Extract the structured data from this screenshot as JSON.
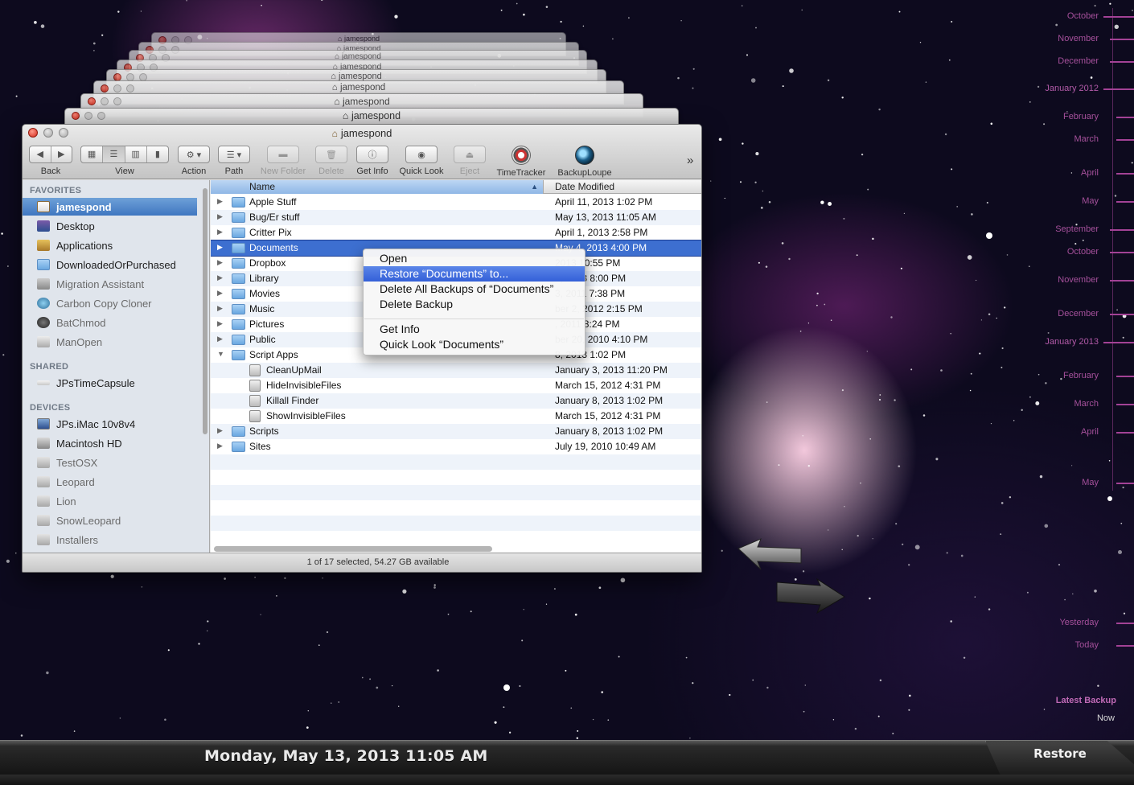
{
  "window": {
    "title": "jamespond",
    "stack_title": "jamespond"
  },
  "toolbar": {
    "back_label": "Back",
    "view_label": "View",
    "action_label": "Action",
    "path_label": "Path",
    "new_folder_label": "New Folder",
    "delete_label": "Delete",
    "get_info_label": "Get Info",
    "quick_look_label": "Quick Look",
    "eject_label": "Eject",
    "timetracker_label": "TimeTracker",
    "backuploupe_label": "BackupLoupe",
    "overflow_glyph": "»"
  },
  "sidebar": {
    "favorites_header": "FAVORITES",
    "shared_header": "SHARED",
    "devices_header": "DEVICES",
    "favorites": [
      {
        "label": "jamespond",
        "icon": "home-icon",
        "selected": true
      },
      {
        "label": "Desktop",
        "icon": "desktop-icon"
      },
      {
        "label": "Applications",
        "icon": "applications-icon"
      },
      {
        "label": "DownloadedOrPurchased",
        "icon": "folder-icon"
      },
      {
        "label": "Migration Assistant",
        "icon": "migration-assistant-icon",
        "dim": true
      },
      {
        "label": "Carbon Copy Cloner",
        "icon": "carbon-copy-cloner-icon",
        "dim": true
      },
      {
        "label": "BatChmod",
        "icon": "batchmod-icon",
        "dim": true
      },
      {
        "label": "ManOpen",
        "icon": "manopen-icon",
        "dim": true
      }
    ],
    "shared": [
      {
        "label": "JPsTimeCapsule",
        "icon": "time-capsule-icon"
      }
    ],
    "devices": [
      {
        "label": "JPs.iMac 10v8v4",
        "icon": "imac-icon"
      },
      {
        "label": "Macintosh HD",
        "icon": "hard-drive-icon"
      },
      {
        "label": "TestOSX",
        "icon": "disk-icon",
        "dim": true
      },
      {
        "label": "Leopard",
        "icon": "disk-icon",
        "dim": true
      },
      {
        "label": "Lion",
        "icon": "disk-icon",
        "dim": true
      },
      {
        "label": "SnowLeopard",
        "icon": "disk-icon",
        "dim": true
      },
      {
        "label": "Installers",
        "icon": "disk-icon",
        "dim": true
      }
    ]
  },
  "list": {
    "col_name": "Name",
    "col_date": "Date Modified",
    "rows": [
      {
        "name": "Apple Stuff",
        "date": "April 11, 2013 1:02 PM",
        "kind": "folder",
        "level": 0
      },
      {
        "name": "Bug/Er stuff",
        "date": "May 13, 2013 11:05 AM",
        "kind": "folder",
        "level": 0
      },
      {
        "name": "Critter Pix",
        "date": "April 1, 2013 2:58 PM",
        "kind": "folder",
        "level": 0
      },
      {
        "name": "Documents",
        "date": "May 4, 2013 4:00 PM",
        "kind": "folder",
        "level": 0,
        "selected": true
      },
      {
        "name": "Dropbox",
        "date": "2013 10:55 PM",
        "kind": "folder",
        "level": 0
      },
      {
        "name": "Library",
        "date": "8, 2013 8:00 PM",
        "kind": "folder",
        "level": 0
      },
      {
        "name": "Movies",
        "date": "3, 2011 7:38 PM",
        "kind": "folder",
        "level": 0
      },
      {
        "name": "Music",
        "date": "ber 2, 2012 2:15 PM",
        "kind": "folder",
        "level": 0
      },
      {
        "name": "Pictures",
        "date": ", 2011 8:24 PM",
        "kind": "folder",
        "level": 0
      },
      {
        "name": "Public",
        "date": "ber 20, 2010 4:10 PM",
        "kind": "folder",
        "level": 0
      },
      {
        "name": "Script Apps",
        "date": "8, 2013 1:02 PM",
        "kind": "folder",
        "level": 0,
        "expanded": true
      },
      {
        "name": "CleanUpMail",
        "date": "January 3, 2013 11:20 PM",
        "kind": "app",
        "level": 1
      },
      {
        "name": "HideInvisibleFiles",
        "date": "March 15, 2012 4:31 PM",
        "kind": "app",
        "level": 1
      },
      {
        "name": "Killall Finder",
        "date": "January 8, 2013 1:02 PM",
        "kind": "app",
        "level": 1
      },
      {
        "name": "ShowInvisibleFiles",
        "date": "March 15, 2012 4:31 PM",
        "kind": "app",
        "level": 1
      },
      {
        "name": "Scripts",
        "date": "January 8, 2013 1:02 PM",
        "kind": "folder",
        "level": 0
      },
      {
        "name": "Sites",
        "date": "July 19, 2010 10:49 AM",
        "kind": "folder",
        "level": 0
      }
    ]
  },
  "status": "1 of 17 selected, 54.27 GB available",
  "context_menu": {
    "items": [
      {
        "label": "Open"
      },
      {
        "label": "Restore “Documents” to...",
        "highlighted": true
      },
      {
        "label": "Delete All Backups of “Documents”"
      },
      {
        "label": "Delete Backup"
      },
      {
        "label": "Get Info"
      },
      {
        "label": "Quick Look “Documents”"
      }
    ]
  },
  "timeline": {
    "labels": [
      "October",
      "November",
      "December",
      "January 2012",
      "February",
      "March",
      "April",
      "May",
      "September",
      "October",
      "November",
      "December",
      "January 2013",
      "February",
      "March",
      "April",
      "May",
      "Yesterday",
      "Today",
      "Latest Backup",
      "Now"
    ]
  },
  "bottom_bar": {
    "date": "Monday, May 13, 2013 11:05 AM",
    "restore_label": "Restore"
  },
  "colors": {
    "selection": "#3d6fd0",
    "timeline_magenta": "#a34296",
    "sidebar_bg": "#e0e5ec"
  }
}
